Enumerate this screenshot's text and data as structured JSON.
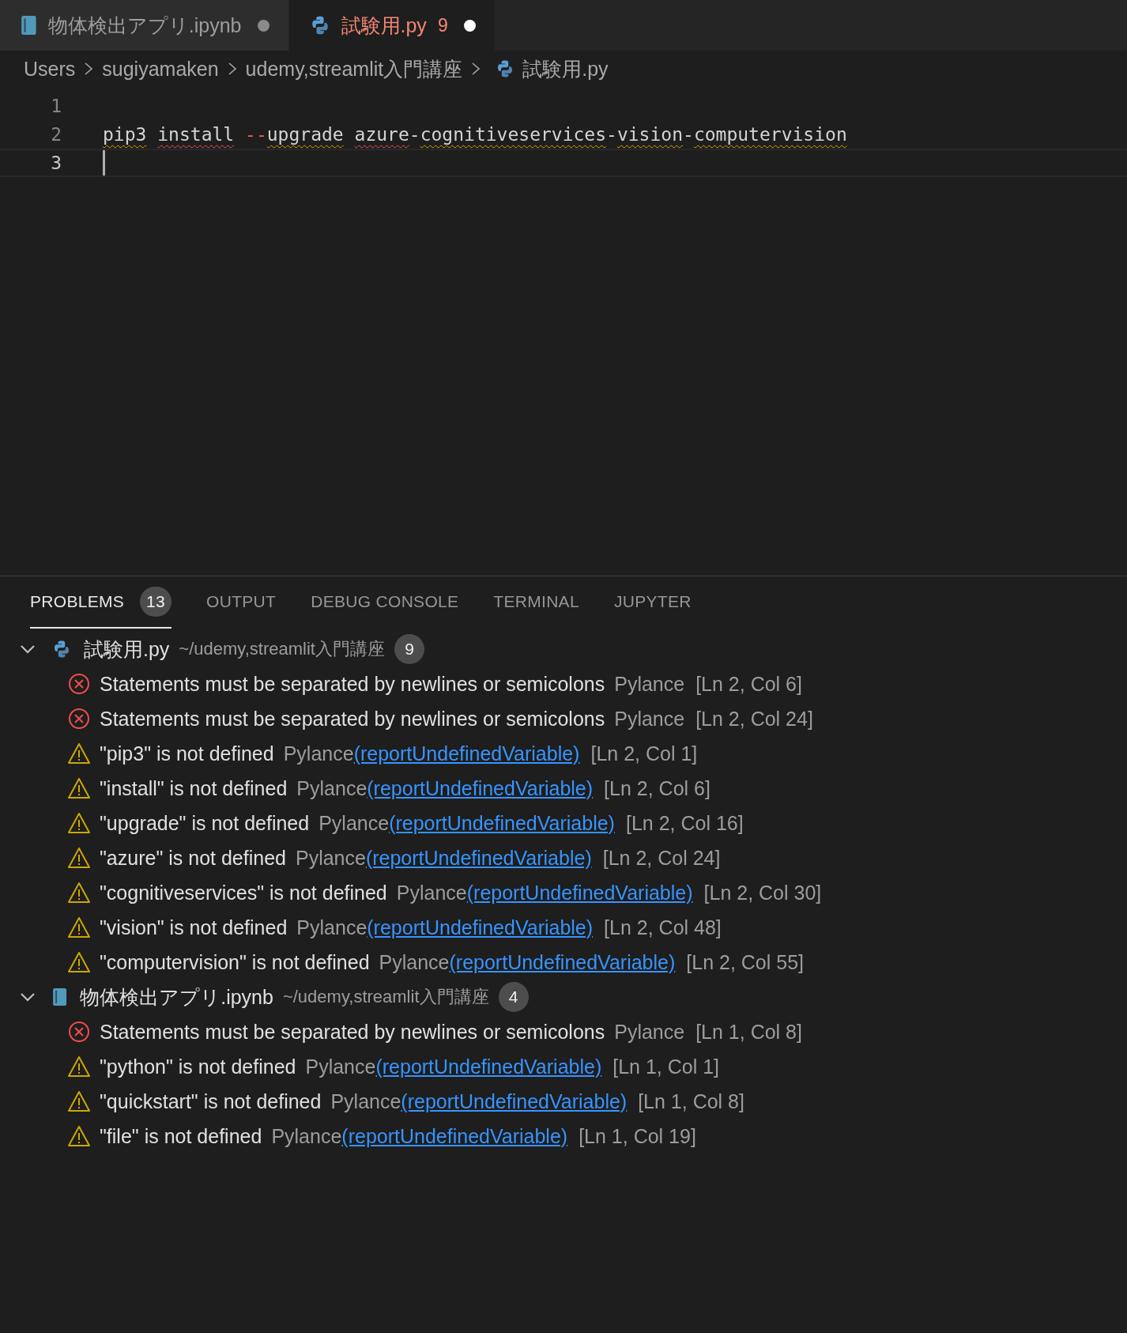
{
  "editor_tabs": [
    {
      "label": "物体検出アプリ.ipynb",
      "kind": "notebook",
      "selected": false,
      "dirty": true
    },
    {
      "label": "試験用.py",
      "kind": "python",
      "selected": true,
      "dirty": true,
      "problem_count": "9"
    }
  ],
  "breadcrumbs": [
    {
      "label": "Users"
    },
    {
      "label": "sugiyamaken"
    },
    {
      "label": "udemy,streamlit入門講座"
    },
    {
      "label": "試験用.py",
      "kind": "python"
    }
  ],
  "code_lines": [
    {
      "number": "1",
      "current": false
    },
    {
      "number": "2",
      "current": false,
      "tokens": [
        {
          "text": "pip3",
          "kind": "warning"
        },
        {
          "text": " install",
          "kind": "error"
        },
        {
          "text": " --",
          "kind": "operator"
        },
        {
          "text": "upgrade",
          "kind": "warning"
        },
        {
          "text": " azure",
          "kind": "error"
        },
        {
          "text": "-",
          "kind": "plain"
        },
        {
          "text": "cognitiveservices",
          "kind": "warning"
        },
        {
          "text": "-",
          "kind": "plain"
        },
        {
          "text": "vision",
          "kind": "warning"
        },
        {
          "text": "-",
          "kind": "plain"
        },
        {
          "text": "computervision",
          "kind": "warning"
        }
      ]
    },
    {
      "number": "3",
      "current": true
    }
  ],
  "panel_tabs": [
    {
      "label": "PROBLEMS",
      "selected": true,
      "badge": "13"
    },
    {
      "label": "OUTPUT",
      "selected": false
    },
    {
      "label": "DEBUG CONSOLE",
      "selected": false
    },
    {
      "label": "TERMINAL",
      "selected": false
    },
    {
      "label": "JUPYTER",
      "selected": false
    }
  ],
  "problem_groups": [
    {
      "file": "試験用.py",
      "kind": "python",
      "path": "~/udemy,streamlit入門講座",
      "count": "9",
      "expanded": true,
      "items": [
        {
          "kind": "error",
          "message": "Statements must be separated by newlines or semicolons",
          "source": "Pylance",
          "location": "[Ln 2, Col 6]"
        },
        {
          "kind": "error",
          "message": "Statements must be separated by newlines or semicolons",
          "source": "Pylance",
          "location": "[Ln 2, Col 24]"
        },
        {
          "kind": "warning",
          "message": "\"pip3\" is not defined",
          "source": "Pylance",
          "code": "(reportUndefinedVariable)",
          "location": "[Ln 2, Col 1]"
        },
        {
          "kind": "warning",
          "message": "\"install\" is not defined",
          "source": "Pylance",
          "code": "(reportUndefinedVariable)",
          "location": "[Ln 2, Col 6]"
        },
        {
          "kind": "warning",
          "message": "\"upgrade\" is not defined",
          "source": "Pylance",
          "code": "(reportUndefinedVariable)",
          "location": "[Ln 2, Col 16]"
        },
        {
          "kind": "warning",
          "message": "\"azure\" is not defined",
          "source": "Pylance",
          "code": "(reportUndefinedVariable)",
          "location": "[Ln 2, Col 24]"
        },
        {
          "kind": "warning",
          "message": "\"cognitiveservices\" is not defined",
          "source": "Pylance",
          "code": "(reportUndefinedVariable)",
          "location": "[Ln 2, Col 30]"
        },
        {
          "kind": "warning",
          "message": "\"vision\" is not defined",
          "source": "Pylance",
          "code": "(reportUndefinedVariable)",
          "location": "[Ln 2, Col 48]"
        },
        {
          "kind": "warning",
          "message": "\"computervision\" is not defined",
          "source": "Pylance",
          "code": "(reportUndefinedVariable)",
          "location": "[Ln 2, Col 55]"
        }
      ]
    },
    {
      "file": "物体検出アプリ.ipynb",
      "kind": "notebook",
      "path": "~/udemy,streamlit入門講座",
      "count": "4",
      "expanded": true,
      "items": [
        {
          "kind": "error",
          "message": "Statements must be separated by newlines or semicolons",
          "source": "Pylance",
          "location": "[Ln 1, Col 8]"
        },
        {
          "kind": "warning",
          "message": "\"python\" is not defined",
          "source": "Pylance",
          "code": "(reportUndefinedVariable)",
          "location": "[Ln 1, Col 1]"
        },
        {
          "kind": "warning",
          "message": "\"quickstart\" is not defined",
          "source": "Pylance",
          "code": "(reportUndefinedVariable)",
          "location": "[Ln 1, Col 8]"
        },
        {
          "kind": "warning",
          "message": "\"file\" is not defined",
          "source": "Pylance",
          "code": "(reportUndefinedVariable)",
          "location": "[Ln 1, Col 19]"
        }
      ]
    }
  ]
}
